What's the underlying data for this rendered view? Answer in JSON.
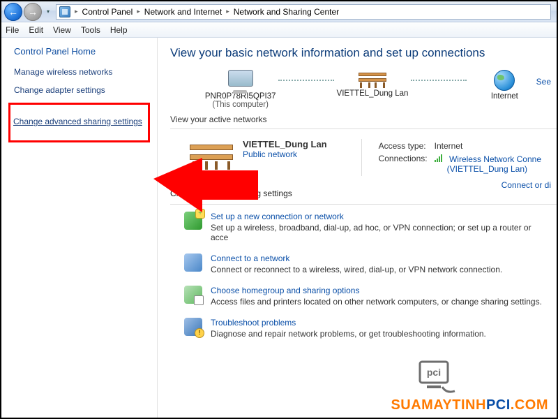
{
  "toolbar": {
    "back_glyph": "←",
    "fwd_glyph": "→",
    "drop_glyph": "▾"
  },
  "breadcrumbs": {
    "seg1": "Control Panel",
    "seg2": "Network and Internet",
    "seg3": "Network and Sharing Center",
    "sep": "▸"
  },
  "menu": {
    "file": "File",
    "edit": "Edit",
    "view": "View",
    "tools": "Tools",
    "help": "Help"
  },
  "sidebar": {
    "home": "Control Panel Home",
    "link1": "Manage wireless networks",
    "link2": "Change adapter settings",
    "link3": "Change advanced sharing settings"
  },
  "main": {
    "heading": "View your basic network information and set up connections",
    "see_link": "See",
    "map": {
      "computer_name": "PNR0P78RI5QPI37",
      "computer_sub": "(This computer)",
      "network_name": "VIETTEL_Dung Lan",
      "internet": "Internet"
    },
    "active_label": "View your active networks",
    "connect_link": "Connect or di",
    "active_net": {
      "name": "VIETTEL_Dung Lan",
      "type": "Public network",
      "access_label": "Access type:",
      "access_value": "Internet",
      "conn_label": "Connections:",
      "conn_value": "Wireless Network Conne",
      "conn_sub": "(VIETTEL_Dung Lan)"
    },
    "change_head": "Change your networking settings",
    "tasks": {
      "t1_link": "Set up a new connection or network",
      "t1_desc": "Set up a wireless, broadband, dial-up, ad hoc, or VPN connection; or set up a router or acce",
      "t2_link": "Connect to a network",
      "t2_desc": "Connect or reconnect to a wireless, wired, dial-up, or VPN network connection.",
      "t3_link": "Choose homegroup and sharing options",
      "t3_desc": "Access files and printers located on other network computers, or change sharing settings.",
      "t4_link": "Troubleshoot problems",
      "t4_desc": "Diagnose and repair network problems, or get troubleshooting information."
    }
  },
  "watermark": {
    "text1": "SUAMAYTINH",
    "text2": "PCI",
    "text3": ".COM"
  }
}
